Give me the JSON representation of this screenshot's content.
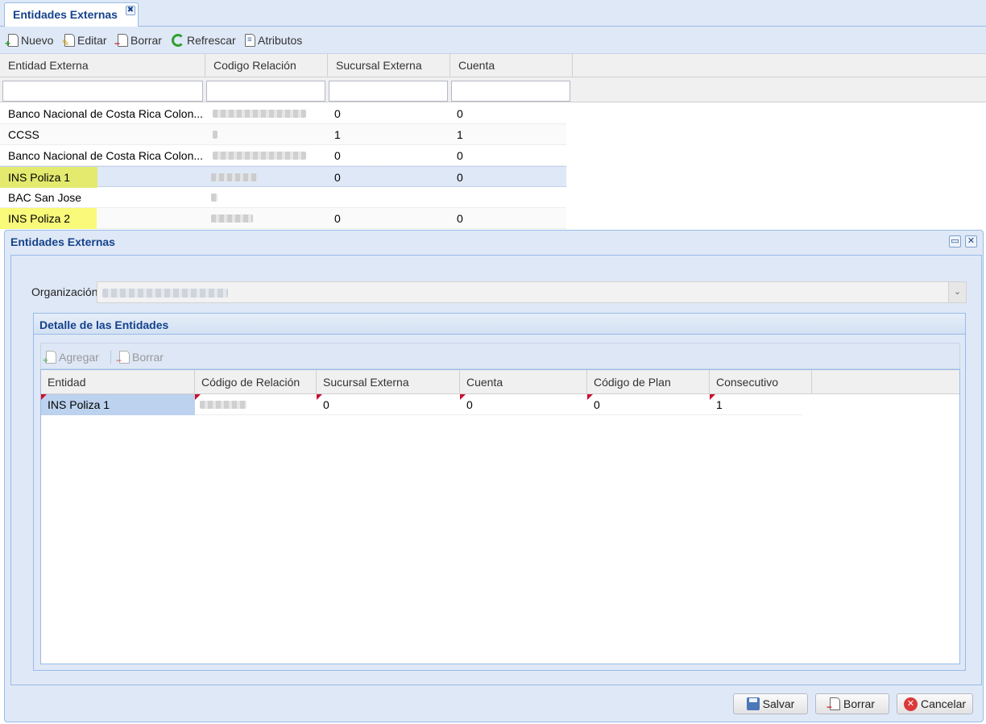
{
  "tab": {
    "title": "Entidades Externas",
    "close_glyph": "✖"
  },
  "toolbar": {
    "new_label": "Nuevo",
    "edit_label": "Editar",
    "delete_label": "Borrar",
    "refresh_label": "Refrescar",
    "attributes_label": "Atributos"
  },
  "grid": {
    "columns": [
      "Entidad Externa",
      "Codigo Relación",
      "Sucursal Externa",
      "Cuenta"
    ],
    "rows": [
      {
        "entidad": "Banco Nacional de Costa Rica Colon...",
        "sucursal": "0",
        "cuenta": "0"
      },
      {
        "entidad": "CCSS",
        "sucursal": "1",
        "cuenta": "1"
      },
      {
        "entidad": "Banco Nacional de Costa Rica Colon...",
        "sucursal": "0",
        "cuenta": "0"
      },
      {
        "entidad": "INS Poliza 1",
        "sucursal": "0",
        "cuenta": "0"
      },
      {
        "entidad": "BAC San Jose",
        "sucursal": "",
        "cuenta": ""
      },
      {
        "entidad": "INS Poliza 2",
        "sucursal": "0",
        "cuenta": "0"
      }
    ]
  },
  "window": {
    "title": "Entidades Externas",
    "maximize_glyph": "▭",
    "close_glyph": "✕",
    "org_label": "Organización",
    "combo_trigger_glyph": "⌄",
    "fieldset_title": "Detalle de las Entidades",
    "subtoolbar": {
      "add_label": "Agregar",
      "delete_label": "Borrar"
    },
    "subgrid": {
      "columns": [
        "Entidad",
        "Código de Relación",
        "Sucursal Externa",
        "Cuenta",
        "Código de Plan",
        "Consecutivo"
      ],
      "rows": [
        {
          "entidad": "INS Poliza 1",
          "sucursal": "0",
          "cuenta": "0",
          "plan": "0",
          "consecutivo": "1"
        }
      ]
    },
    "buttons": {
      "save_label": "Salvar",
      "delete_label": "Borrar",
      "cancel_label": "Cancelar",
      "cancel_glyph": "✕"
    }
  }
}
